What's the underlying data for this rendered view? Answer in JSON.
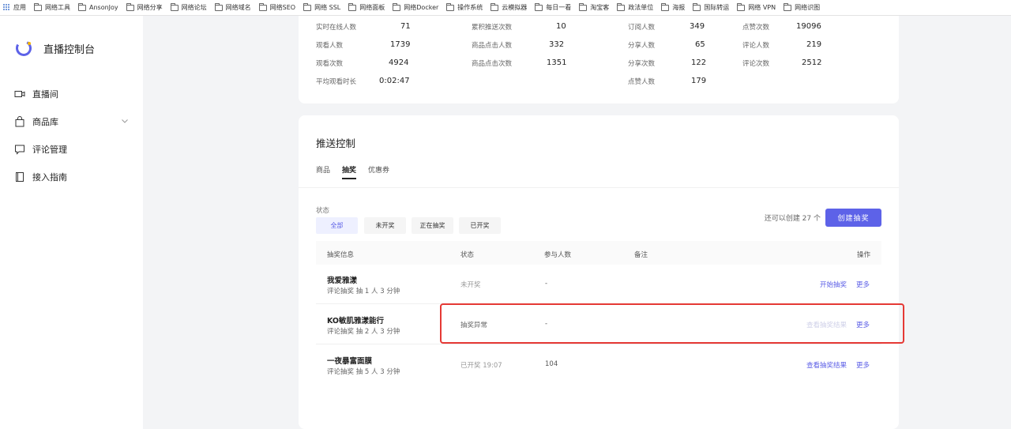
{
  "bookmarks": {
    "apps_label": "应用",
    "items": [
      "网络工具",
      "AnsonJoy",
      "网络分享",
      "网络论坛",
      "网络域名",
      "网络SEO",
      "网络 SSL",
      "网络面板",
      "网络Docker",
      "操作系统",
      "云模拟器",
      "每日一看",
      "淘宝客",
      "政法单位",
      "海报",
      "国际转运",
      "网络 VPN",
      "网络识图"
    ]
  },
  "sidebar": {
    "title": "直播控制台",
    "items": [
      {
        "label": "直播间"
      },
      {
        "label": "商品库"
      },
      {
        "label": "评论管理"
      },
      {
        "label": "接入指南"
      }
    ]
  },
  "stats": [
    {
      "label": "实时在线人数",
      "value": "71"
    },
    {
      "label": "观看人数",
      "value": "1739"
    },
    {
      "label": "观看次数",
      "value": "4924"
    },
    {
      "label": "平均观看时长",
      "value": "0:02:47"
    },
    {
      "label": "累积推送次数",
      "value": "10"
    },
    {
      "label": "商品点击人数",
      "value": "332"
    },
    {
      "label": "商品点击次数",
      "value": "1351"
    },
    {
      "label": "订阅人数",
      "value": "349"
    },
    {
      "label": "分享人数",
      "value": "65"
    },
    {
      "label": "分享次数",
      "value": "122"
    },
    {
      "label": "点赞人数",
      "value": "179"
    },
    {
      "label": "点赞次数",
      "value": "19096"
    },
    {
      "label": "评论人数",
      "value": "219"
    },
    {
      "label": "评论次数",
      "value": "2512"
    }
  ],
  "push": {
    "title": "推送控制",
    "tabs": [
      "商品",
      "抽奖",
      "优惠券"
    ],
    "filter_label": "状态",
    "filters": [
      "全部",
      "未开奖",
      "正在抽奖",
      "已开奖"
    ],
    "remaining": "还可以创建 27 个",
    "create_label": "创建抽奖",
    "headers": [
      "抽奖信息",
      "状态",
      "参与人数",
      "备注",
      "操作"
    ],
    "rows": [
      {
        "name": "我爱雅漾",
        "sub": "评论抽奖 抽 1 人 3 分钟",
        "status": "未开奖",
        "count": "-",
        "action": "开始抽奖",
        "more": "更多"
      },
      {
        "name": "KO敏肌雅漾能行",
        "sub": "评论抽奖 抽 2 人 3 分钟",
        "status": "抽奖异常",
        "count": "-",
        "action": "查看抽奖结果",
        "more": "更多"
      },
      {
        "name": "一夜暴富面膜",
        "sub": "评论抽奖 抽 5 人 3 分钟",
        "status": "已开奖 19:07",
        "count": "104",
        "action": "查看抽奖结果",
        "more": "更多"
      }
    ]
  },
  "colors": {
    "accent": "#5d62e8",
    "highlight": "#e53935"
  }
}
